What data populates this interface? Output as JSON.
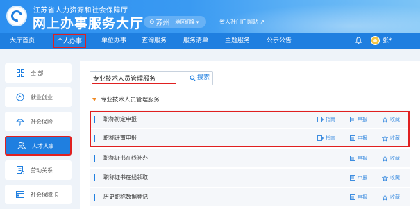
{
  "header": {
    "org_name": "江苏省人力资源和社会保障厅",
    "site_title": "网上办事服务大厅",
    "city": "苏州",
    "region_switch": "地区切换",
    "portal_link": "省人社门户网站"
  },
  "nav": {
    "items": [
      {
        "label": "大厅首页"
      },
      {
        "label": "个人办事"
      },
      {
        "label": "单位办事"
      },
      {
        "label": "查询服务"
      },
      {
        "label": "服务清单"
      },
      {
        "label": "主题服务"
      },
      {
        "label": "公示公告"
      }
    ],
    "active_index": 1,
    "user_name": "张*"
  },
  "sidebar": {
    "items": [
      {
        "label": "全 部",
        "icon": "grid-icon"
      },
      {
        "label": "就业创业",
        "icon": "briefcase-icon"
      },
      {
        "label": "社会保险",
        "icon": "umbrella-icon"
      },
      {
        "label": "人才人事",
        "icon": "people-icon"
      },
      {
        "label": "劳动关系",
        "icon": "document-icon"
      },
      {
        "label": "社会保障卡",
        "icon": "card-icon"
      }
    ],
    "active_index": 3
  },
  "search": {
    "value": "专业技术人员管理服务",
    "button_label": "搜索"
  },
  "category": {
    "title": "专业技术人员管理服务"
  },
  "services": [
    {
      "name": "职称初定申报",
      "guide": "指南",
      "apply": "申报",
      "fav": "收藏"
    },
    {
      "name": "职称评审申报",
      "guide": "指南",
      "apply": "申报",
      "fav": "收藏"
    },
    {
      "name": "职称证书在线补办",
      "apply": "申报",
      "fav": "收藏"
    },
    {
      "name": "职称证书在线领取",
      "apply": "申报",
      "fav": "收藏"
    },
    {
      "name": "历史职称数据登记",
      "apply": "申报",
      "fav": "收藏"
    }
  ],
  "colors": {
    "primary": "#1f7fe0",
    "highlight_red": "#e02020",
    "accent_orange": "#f08a24"
  }
}
